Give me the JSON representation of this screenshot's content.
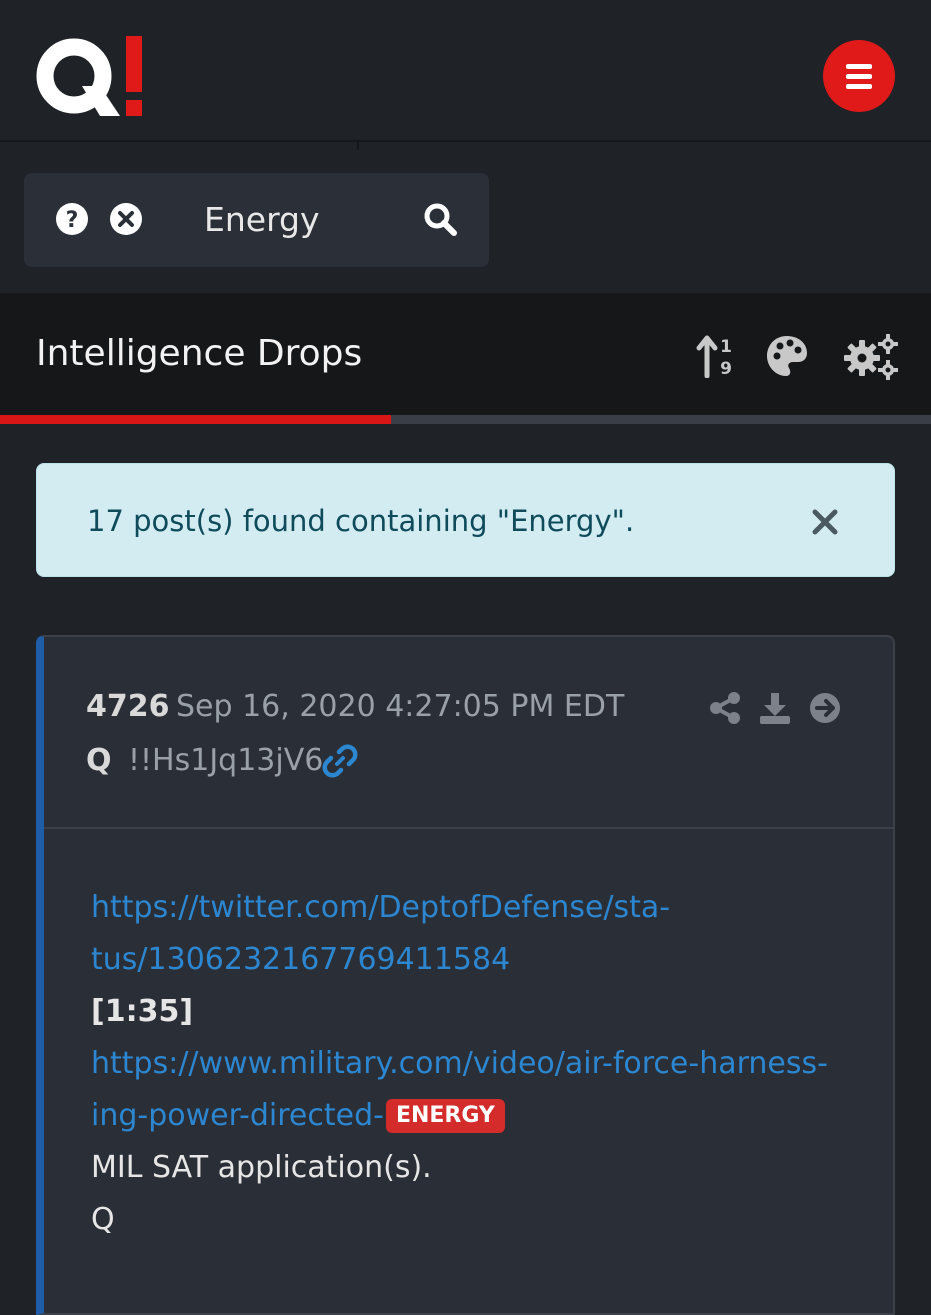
{
  "search": {
    "value": "Energy"
  },
  "header": {
    "title": "Intelligence Drops",
    "progress": 0.42
  },
  "alert": {
    "text": "17 post(s) found containing \"Energy\"."
  },
  "post": {
    "number": "4726",
    "date": "Sep 16, 2020 4:27:05 PM EDT",
    "author": "Q",
    "trip": "!!Hs1Jq13jV6",
    "lines": {
      "link1a": "https://twitter.com/DeptofDefense/sta-",
      "link1b": "tus/1306232167769411584",
      "duration": "[1:35]",
      "link2a": "https://www.military.com/video/air-force-harness-",
      "link2b": "ing-power-directed-",
      "highlight": "ENERGY",
      "text1": "MIL SAT application(s).",
      "text2": "Q"
    }
  },
  "colors": {
    "accent": "#e01919",
    "link": "#2c86d0",
    "card_border": "#1f5da8",
    "alert_bg": "#d2ecf2"
  },
  "icons": [
    "menu-icon",
    "help-icon",
    "clear-icon",
    "search-icon",
    "sort-numeric-icon",
    "palette-icon",
    "gears-icon",
    "close-icon",
    "share-icon",
    "download-icon",
    "arrow-right-icon",
    "link-icon"
  ]
}
